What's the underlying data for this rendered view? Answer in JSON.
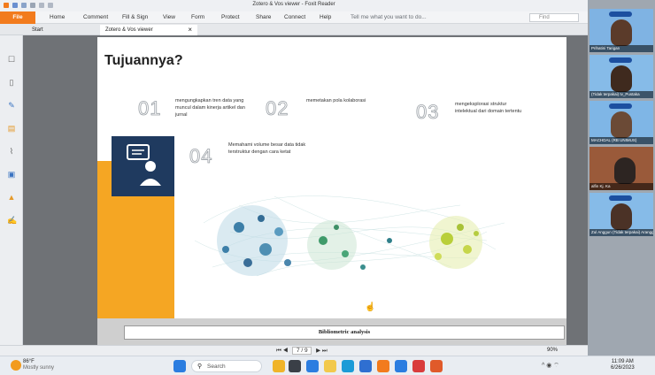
{
  "window": {
    "title": "Zotero & Vos viewer - Foxit Reader"
  },
  "ribbon": {
    "file": "File",
    "tabs": [
      "Home",
      "Comment",
      "Fill & Sign",
      "View",
      "Form",
      "Protect",
      "Share",
      "Connect",
      "Help"
    ],
    "tell_me": "Tell me what you want to do...",
    "find_placeholder": "Find"
  },
  "doc_tabs": {
    "start": "Start",
    "current": "Zotero & Vos viewer"
  },
  "slide": {
    "title": "Tujuannya?",
    "items": [
      {
        "num": "01",
        "text": "mengungkapkan tren data yang muncul dalam kinerja artikel dan jurnal"
      },
      {
        "num": "02",
        "text": "memetakan pola kolaborasi"
      },
      {
        "num": "03",
        "text": "mengeksplorasi struktur intelektual dari domain tertentu"
      },
      {
        "num": "04",
        "text": "Memahami volume besar data tidak terstruktur dengan cara ketat"
      }
    ],
    "footer": "Bibliometric analysis"
  },
  "status": {
    "page_display": "7 / 9",
    "zoom": "90%"
  },
  "video_tiles": [
    {
      "name": "Prihatini Tarigan"
    },
    {
      "name": "(Tidak terpakai) Iv_Pustaka"
    },
    {
      "name": "MACHDAL (RB UNIMUS)"
    },
    {
      "name": "alfin Kj. Ka"
    },
    {
      "name": "Zul Anggun (Tidak terpakai) Arangg..."
    }
  ],
  "taskbar": {
    "weather_temp": "86°F",
    "weather_desc": "Mostly sunny",
    "search_label": "Search",
    "time": "11:09 AM",
    "date": "6/26/2023"
  },
  "colors": {
    "accent_orange": "#f27b1d",
    "slide_yellow": "#f5a623",
    "slide_navy": "#1f3a5f"
  }
}
